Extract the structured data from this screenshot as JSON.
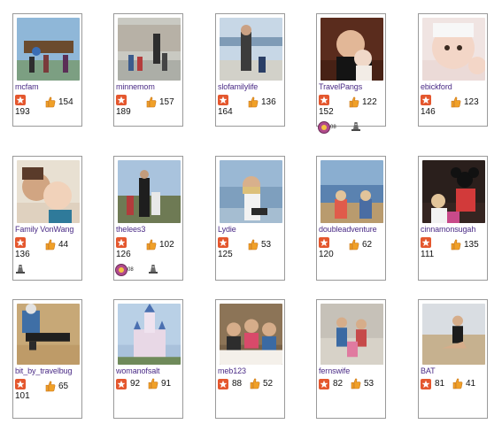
{
  "cards": [
    {
      "user": "mcfam",
      "stars": "193",
      "likes": "154",
      "photo_theme": "family-sign-outdoors"
    },
    {
      "user": "minnemom",
      "stars": "189",
      "likes": "157",
      "photo_theme": "family-by-building"
    },
    {
      "user": "slofamilylife",
      "stars": "164",
      "likes": "136",
      "photo_theme": "parent-child-beach"
    },
    {
      "user": "TravelPangs",
      "stars": "152",
      "likes": "122",
      "photo_theme": "parent-baby-portrait",
      "award": "08",
      "has_tower": true
    },
    {
      "user": "ebickford",
      "stars": "146",
      "likes": "123",
      "photo_theme": "baby-closeup"
    },
    {
      "user": "Family VonWang",
      "stars": "136",
      "likes": "44",
      "photo_theme": "mother-baby-closeup",
      "has_tower": true
    },
    {
      "user": "thelees3",
      "stars": "126",
      "likes": "102",
      "photo_theme": "family-landmark",
      "award": "08",
      "has_tower": true
    },
    {
      "user": "Lydie",
      "stars": "125",
      "likes": "53",
      "photo_theme": "girl-by-lake"
    },
    {
      "user": "doubleadventure",
      "stars": "120",
      "likes": "62",
      "photo_theme": "kids-by-lake"
    },
    {
      "user": "cinnamonsugah",
      "stars": "111",
      "likes": "135",
      "photo_theme": "kids-with-character"
    },
    {
      "user": "bit_by_travelbug",
      "stars": "101",
      "likes": "65",
      "photo_theme": "child-on-sand"
    },
    {
      "user": "womanofsalt",
      "stars": "92",
      "likes": "91",
      "photo_theme": "fairytale-castle"
    },
    {
      "user": "meb123",
      "stars": "88",
      "likes": "52",
      "photo_theme": "family-at-table"
    },
    {
      "user": "fernswife",
      "stars": "82",
      "likes": "53",
      "photo_theme": "family-posing"
    },
    {
      "user": "BAT",
      "stars": "81",
      "likes": "41",
      "photo_theme": "woman-sitting-desert"
    }
  ],
  "colors": {
    "username": "#4a2b86",
    "star_badge": "#e4572e",
    "thumb": "#f0a028",
    "border": "#9a9a9a"
  },
  "icons": {
    "star": "star-icon",
    "thumb": "thumbs-up-icon",
    "award": "award-badge-icon",
    "tower": "tower-icon"
  }
}
